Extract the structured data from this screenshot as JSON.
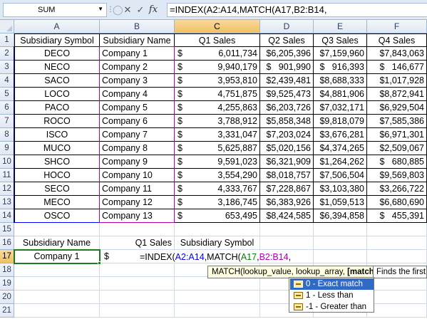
{
  "formula_bar": {
    "name_box": "SUM",
    "formula": "=INDEX(A2:A14,MATCH(A17,B2:B14,",
    "buttons": {
      "cancel": "✕",
      "enter": "✓",
      "function": "fx"
    }
  },
  "columns": [
    "A",
    "B",
    "C",
    "D",
    "E",
    "F"
  ],
  "rows": [
    "1",
    "2",
    "3",
    "4",
    "5",
    "6",
    "7",
    "8",
    "9",
    "10",
    "11",
    "12",
    "13",
    "14",
    "15",
    "16",
    "17",
    "18",
    "19",
    "20",
    "21"
  ],
  "table": {
    "headers": [
      "Subsidiary Symbol",
      "Subsidiary Name",
      "Q1 Sales",
      "Q2 Sales",
      "Q3 Sales",
      "Q4 Sales"
    ],
    "records": [
      {
        "symbol": "DECO",
        "name": "Company 1",
        "q1": "6,011,734",
        "q2": "$6,205,396",
        "q3": "$7,159,960",
        "q4": "$7,843,063"
      },
      {
        "symbol": "NECO",
        "name": "Company 2",
        "q1": "9,940,179",
        "q2": "$   901,990",
        "q3": "$   916,393",
        "q4": "$   146,677"
      },
      {
        "symbol": "SACO",
        "name": "Company 3",
        "q1": "3,953,810",
        "q2": "$2,439,481",
        "q3": "$8,688,333",
        "q4": "$1,017,928"
      },
      {
        "symbol": "LOCO",
        "name": "Company 4",
        "q1": "4,751,875",
        "q2": "$9,525,473",
        "q3": "$4,881,906",
        "q4": "$8,872,941"
      },
      {
        "symbol": "PACO",
        "name": "Company 5",
        "q1": "4,255,863",
        "q2": "$6,203,726",
        "q3": "$7,032,171",
        "q4": "$6,929,504"
      },
      {
        "symbol": "ROCO",
        "name": "Company 6",
        "q1": "3,788,912",
        "q2": "$5,858,348",
        "q3": "$9,818,079",
        "q4": "$7,585,386"
      },
      {
        "symbol": "ISCO",
        "name": "Company 7",
        "q1": "3,331,047",
        "q2": "$7,203,024",
        "q3": "$3,676,281",
        "q4": "$6,971,301"
      },
      {
        "symbol": "MUCO",
        "name": "Company 8",
        "q1": "5,625,887",
        "q2": "$5,020,156",
        "q3": "$4,374,265",
        "q4": "$2,509,067"
      },
      {
        "symbol": "SHCO",
        "name": "Company 9",
        "q1": "9,591,023",
        "q2": "$6,321,909",
        "q3": "$1,264,262",
        "q4": "$   680,885"
      },
      {
        "symbol": "HOCO",
        "name": "Company 10",
        "q1": "3,554,290",
        "q2": "$8,018,757",
        "q3": "$7,506,504",
        "q4": "$9,569,803"
      },
      {
        "symbol": "SECO",
        "name": "Company 11",
        "q1": "4,333,767",
        "q2": "$7,228,867",
        "q3": "$3,103,380",
        "q4": "$3,266,722"
      },
      {
        "symbol": "MECO",
        "name": "Company 12",
        "q1": "3,186,745",
        "q2": "$6,383,926",
        "q3": "$1,059,513",
        "q4": "$6,680,690"
      },
      {
        "symbol": "OSCO",
        "name": "Company 13",
        "q1": "653,495",
        "q2": "$8,424,585",
        "q3": "$6,394,858",
        "q4": "$   455,391"
      }
    ],
    "currency": "$"
  },
  "lookup": {
    "labels": [
      "Subsidiary Name",
      "Q1 Sales",
      "Subsidiary Symbol"
    ],
    "name_value": "Company 1",
    "currency": "$",
    "formula_parts": [
      "=INDEX(",
      "A2:A14",
      ",MATCH(",
      "A17",
      ",",
      "B2:B14",
      ","
    ]
  },
  "tooltip": {
    "signature_prefix": "MATCH(lookup_value, lookup_array, ",
    "signature_bold": "[match",
    "side_text": "Finds the first"
  },
  "dropdown": {
    "items": [
      "0 - Exact match",
      "1 - Less than",
      "-1 - Greater than"
    ],
    "selected_index": 0
  },
  "colors": {
    "range_a": "#0000ff",
    "range_b": "#b000b0",
    "lookup_value": "#008000",
    "active_cell": "#1e7a1e",
    "selected_header": "#f1c15f",
    "dropdown_selected": "#3169c6"
  }
}
